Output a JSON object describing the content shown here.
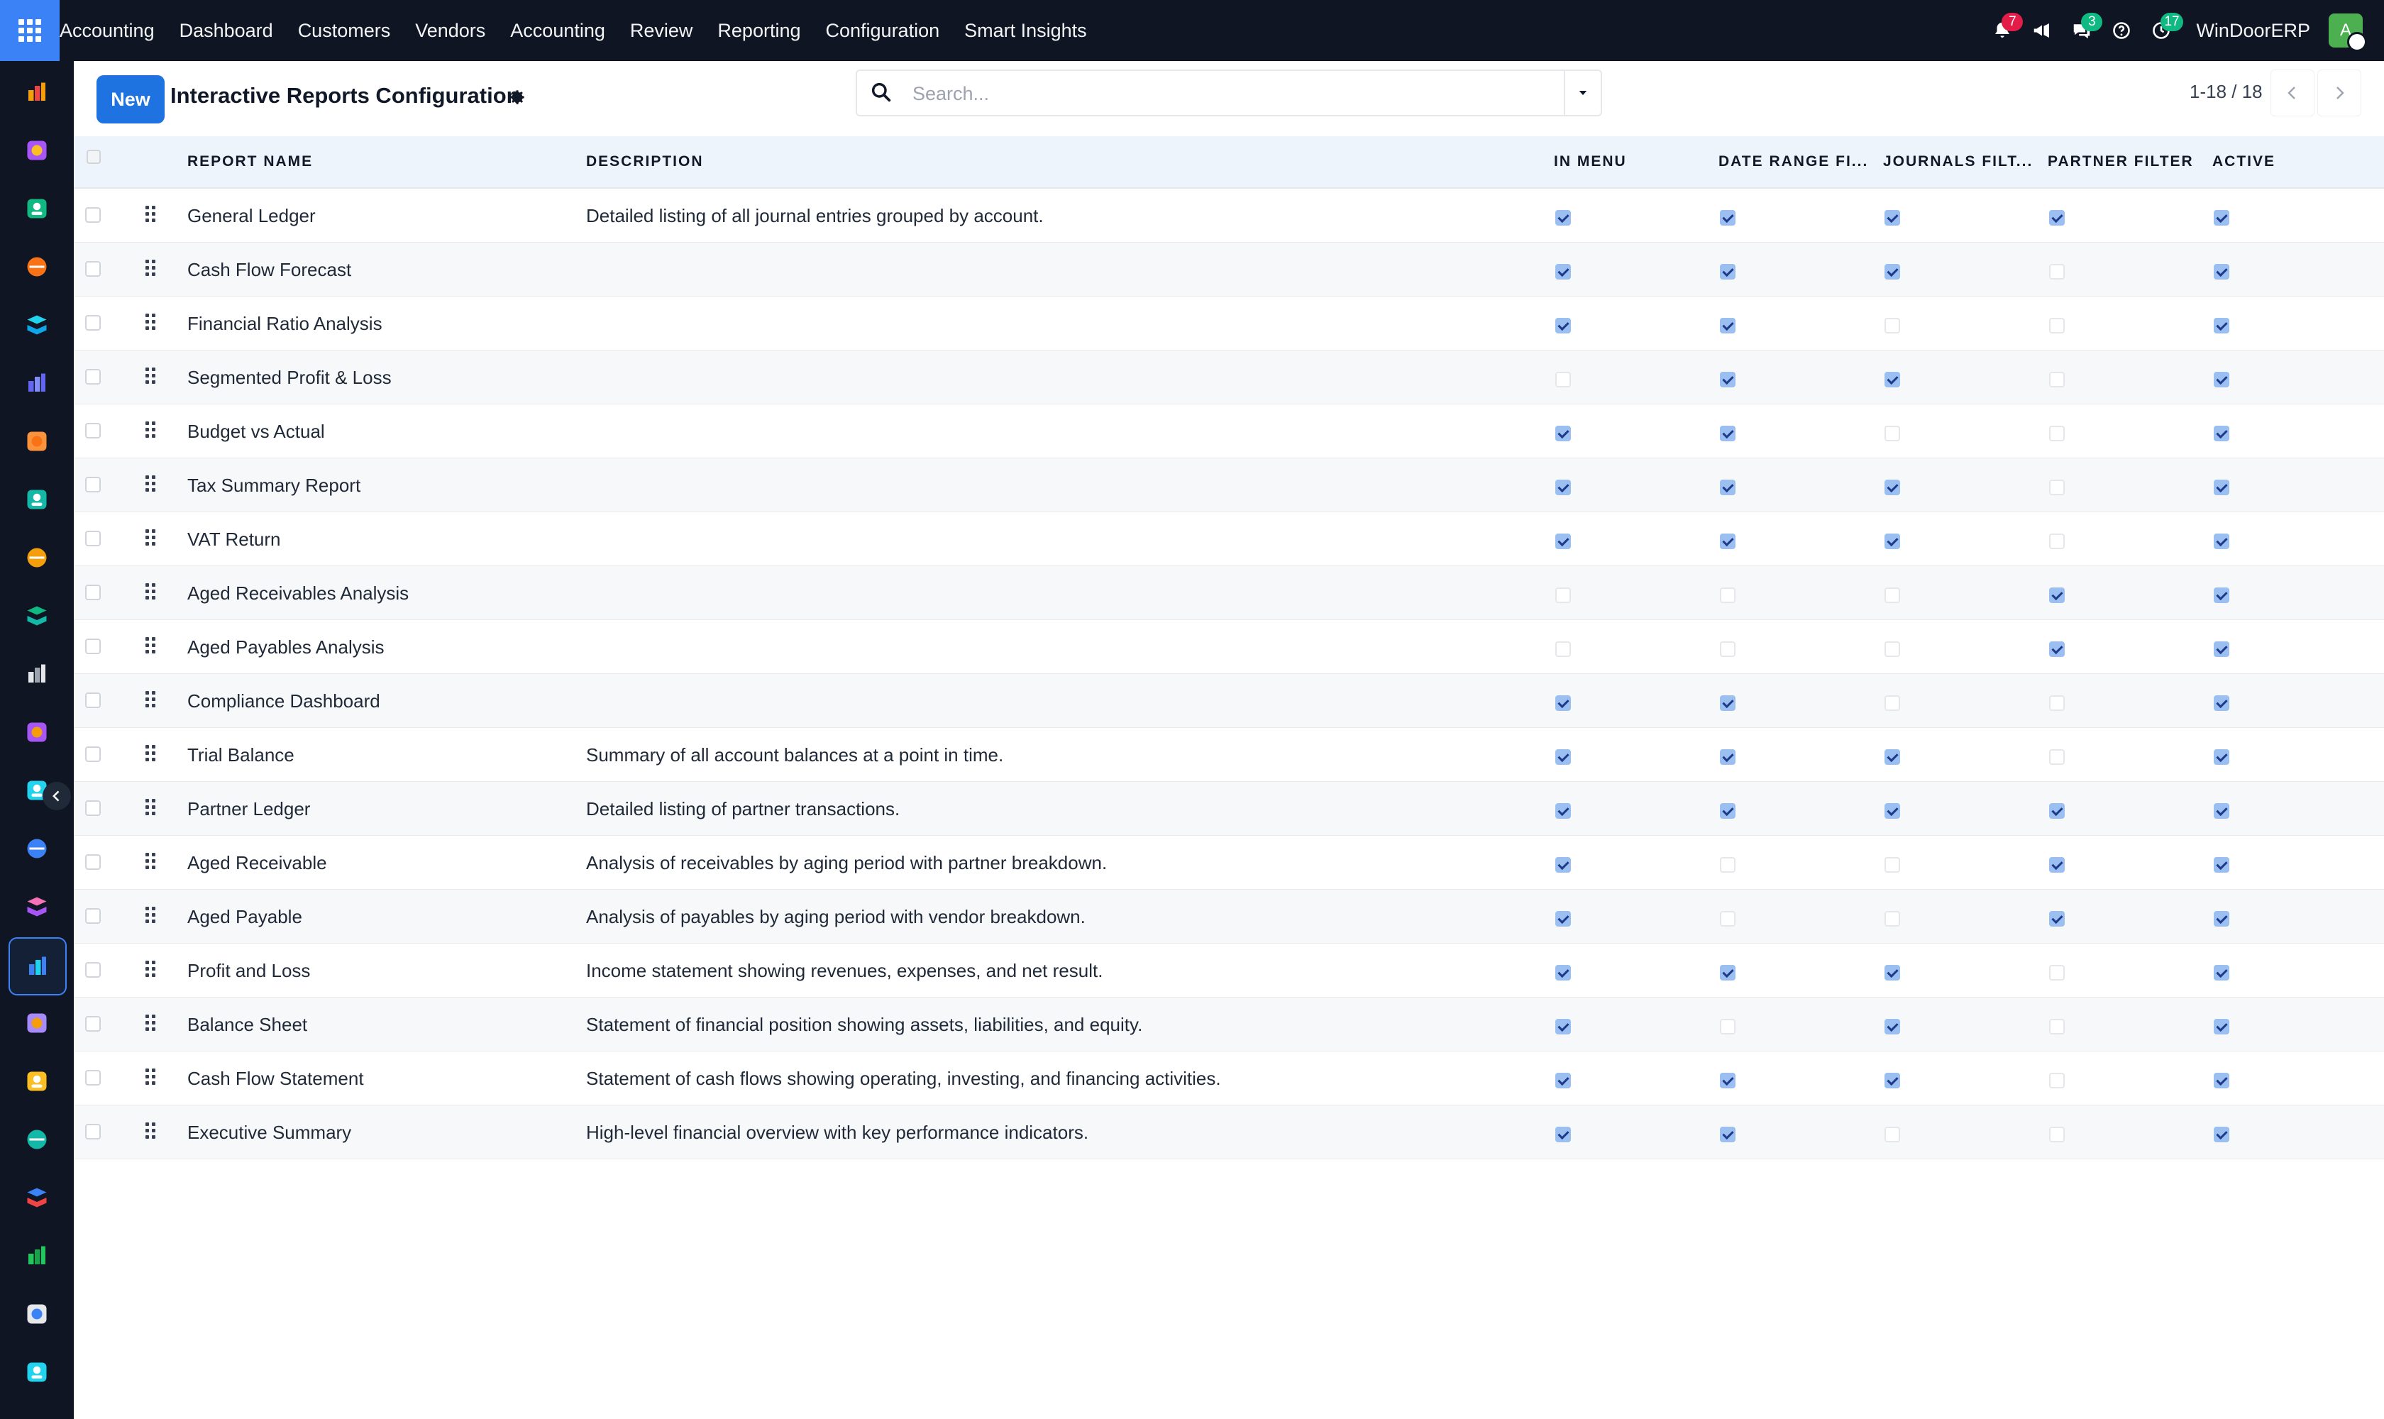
{
  "topbar": {
    "nav": [
      "Accounting",
      "Dashboard",
      "Customers",
      "Vendors",
      "Accounting",
      "Review",
      "Reporting",
      "Configuration",
      "Smart Insights"
    ],
    "notifications_count": "7",
    "messages_count": "3",
    "activities_count": "17",
    "company": "WinDoorERP",
    "avatar_letter": "A"
  },
  "sidebar": {
    "apps": [
      "invoicing-app-icon",
      "project-app-icon",
      "contacts-app-icon",
      "discuss-app-icon",
      "website-app-icon",
      "email-marketing-app-icon",
      "livechat-app-icon",
      "inventory-app-icon",
      "reporting-app-icon",
      "employees-app-icon",
      "package-app-icon",
      "sign-app-icon",
      "todo-app-icon",
      "knowledge-app-icon",
      "product-app-icon",
      "accounting-app-icon",
      "team-app-icon",
      "calendar-app-icon",
      "pen-app-icon",
      "dashboards-app-icon",
      "whatsapp-app-icon",
      "timer-app-icon",
      "website-alt-app-icon"
    ],
    "active_index": 15
  },
  "control": {
    "new_label": "New",
    "title": "Interactive Reports Configuration",
    "search_placeholder": "Search...",
    "pager": "1-18 / 18"
  },
  "table": {
    "columns": {
      "name": "REPORT NAME",
      "description": "DESCRIPTION",
      "in_menu": "IN MENU",
      "date_range": "DATE RANGE FI...",
      "journals": "JOURNALS FILT...",
      "partner": "PARTNER FILTER",
      "active": "ACTIVE"
    },
    "rows": [
      {
        "name": "General Ledger",
        "description": "Detailed listing of all journal entries grouped by account.",
        "flags": [
          true,
          true,
          true,
          true,
          true
        ]
      },
      {
        "name": "Cash Flow Forecast",
        "description": "",
        "flags": [
          true,
          true,
          true,
          false,
          true
        ]
      },
      {
        "name": "Financial Ratio Analysis",
        "description": "",
        "flags": [
          true,
          true,
          false,
          false,
          true
        ]
      },
      {
        "name": "Segmented Profit & Loss",
        "description": "",
        "flags": [
          false,
          true,
          true,
          false,
          true
        ]
      },
      {
        "name": "Budget vs Actual",
        "description": "",
        "flags": [
          true,
          true,
          false,
          false,
          true
        ]
      },
      {
        "name": "Tax Summary Report",
        "description": "",
        "flags": [
          true,
          true,
          true,
          false,
          true
        ]
      },
      {
        "name": "VAT Return",
        "description": "",
        "flags": [
          true,
          true,
          true,
          false,
          true
        ]
      },
      {
        "name": "Aged Receivables Analysis",
        "description": "",
        "flags": [
          false,
          false,
          false,
          true,
          true
        ]
      },
      {
        "name": "Aged Payables Analysis",
        "description": "",
        "flags": [
          false,
          false,
          false,
          true,
          true
        ]
      },
      {
        "name": "Compliance Dashboard",
        "description": "",
        "flags": [
          true,
          true,
          false,
          false,
          true
        ]
      },
      {
        "name": "Trial Balance",
        "description": "Summary of all account balances at a point in time.",
        "flags": [
          true,
          true,
          true,
          false,
          true
        ]
      },
      {
        "name": "Partner Ledger",
        "description": "Detailed listing of partner transactions.",
        "flags": [
          true,
          true,
          true,
          true,
          true
        ]
      },
      {
        "name": "Aged Receivable",
        "description": "Analysis of receivables by aging period with partner breakdown.",
        "flags": [
          true,
          false,
          false,
          true,
          true
        ]
      },
      {
        "name": "Aged Payable",
        "description": "Analysis of payables by aging period with vendor breakdown.",
        "flags": [
          true,
          false,
          false,
          true,
          true
        ]
      },
      {
        "name": "Profit and Loss",
        "description": "Income statement showing revenues, expenses, and net result.",
        "flags": [
          true,
          true,
          true,
          false,
          true
        ]
      },
      {
        "name": "Balance Sheet",
        "description": "Statement of financial position showing assets, liabilities, and equity.",
        "flags": [
          true,
          false,
          true,
          false,
          true
        ]
      },
      {
        "name": "Cash Flow Statement",
        "description": "Statement of cash flows showing operating, investing, and financing activities.",
        "flags": [
          true,
          true,
          true,
          false,
          true
        ]
      },
      {
        "name": "Executive Summary",
        "description": "High-level financial overview with key performance indicators.",
        "flags": [
          true,
          true,
          false,
          false,
          true
        ]
      }
    ]
  }
}
